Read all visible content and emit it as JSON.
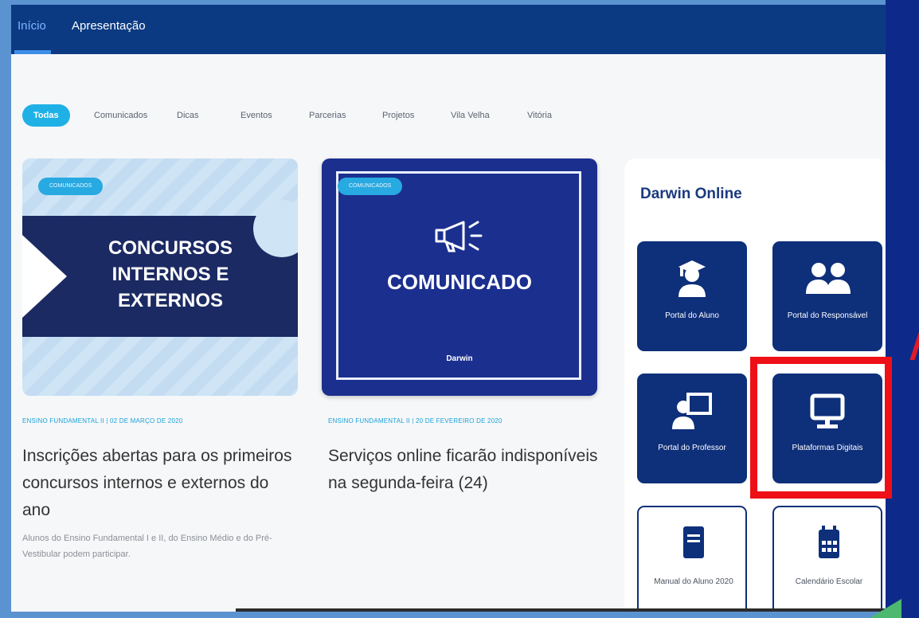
{
  "nav": {
    "items": [
      {
        "label": "Início",
        "active": true
      },
      {
        "label": "Apresentação",
        "active": false
      }
    ]
  },
  "filters": [
    "Todas",
    "Comunicados",
    "Dicas",
    "Eventos",
    "Parcerias",
    "Projetos",
    "Vila Velha",
    "Vitória"
  ],
  "posts": [
    {
      "badge": "COMUNICADOS",
      "banner_lines": [
        "CONCURSOS",
        "INTERNOS E",
        "EXTERNOS"
      ],
      "meta": "ENSINO FUNDAMENTAL II | 02 DE MARÇO DE 2020",
      "title": "Inscrições abertas para os primeiros concursos internos e externos do ano",
      "excerpt": "Alunos do Ensino Fundamental I e II, do Ensino Médio e do Pré-Vestibular podem participar."
    },
    {
      "badge": "COMUNICADOS",
      "banner_title": "COMUNICADO",
      "banner_logo": "Darwin",
      "meta": "ENSINO FUNDAMENTAL II | 20 DE FEVEREIRO DE 2020",
      "title": "Serviços online ficarão indisponíveis na segunda-feira (24)",
      "excerpt": ""
    }
  ],
  "sidebar": {
    "title": "Darwin Online",
    "tiles": [
      {
        "label": "Portal do Aluno",
        "icon": "student-icon"
      },
      {
        "label": "Portal do Responsável",
        "icon": "users-icon"
      },
      {
        "label": "Portal do Professor",
        "icon": "teacher-icon"
      },
      {
        "label": "Plataformas Digitais",
        "icon": "monitor-icon",
        "highlighted": true
      },
      {
        "label": "Manual do Aluno 2020",
        "icon": "book-icon"
      },
      {
        "label": "Calendário Escolar",
        "icon": "calendar-icon"
      }
    ]
  },
  "colors": {
    "nav": "#0b3a82",
    "accent": "#1fb1e6",
    "tile": "#0e2f7a",
    "highlight": "#ef0f16",
    "frame_bg": "#5b93d0"
  }
}
